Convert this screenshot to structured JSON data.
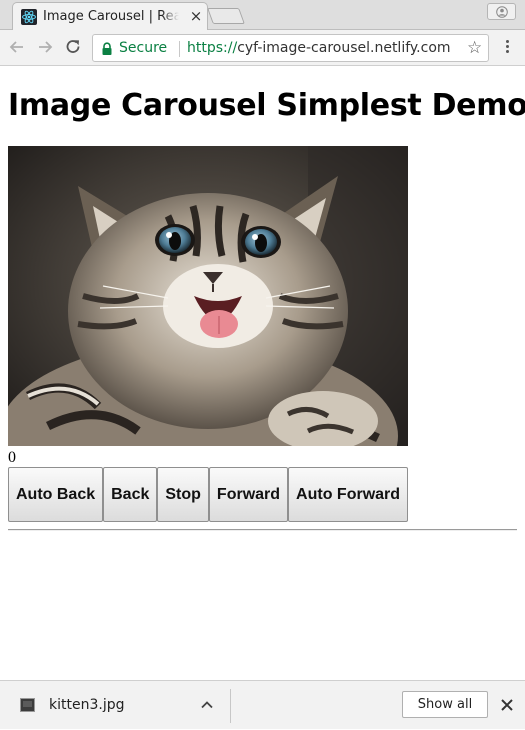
{
  "browser": {
    "tab": {
      "title": "Image Carousel | React App",
      "favicon": "react-icon",
      "close_glyph": "×"
    },
    "toolbar": {
      "security_label": "Secure",
      "url_scheme": "https://",
      "url_host": "cyf-image-carousel.netlify.com",
      "bookmark_glyph": "☆"
    }
  },
  "page": {
    "title": "Image Carousel Simplest Demo",
    "image": {
      "alt": "kitten",
      "icon": "kitten-photo"
    },
    "counter": "0",
    "buttons": [
      {
        "label": "Auto Back"
      },
      {
        "label": "Back"
      },
      {
        "label": "Stop"
      },
      {
        "label": "Forward"
      },
      {
        "label": "Auto Forward"
      }
    ]
  },
  "downloads": {
    "items": [
      {
        "filename": "kitten3.jpg"
      }
    ],
    "show_all_label": "Show all"
  },
  "colors": {
    "secure_green": "#0b8043",
    "react_blue": "#61dafb"
  }
}
